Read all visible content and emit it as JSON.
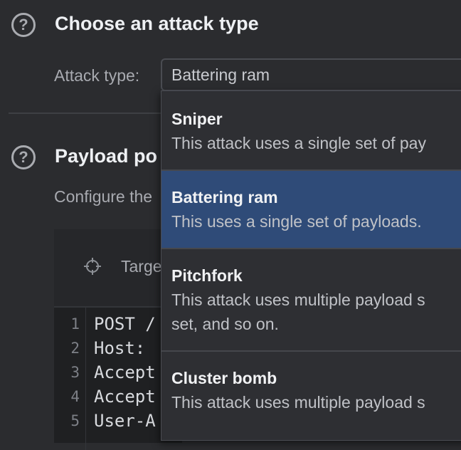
{
  "attack_section": {
    "help_glyph": "?",
    "title": "Choose an attack type",
    "attack_type_label": "Attack type:",
    "selected_value": "Battering ram"
  },
  "payload_section": {
    "help_glyph": "?",
    "title_partial": "Payload po",
    "description_partial": "Configure the"
  },
  "editor": {
    "target_label_partial": "Targe",
    "lines": [
      {
        "num": "1",
        "text": "POST /"
      },
      {
        "num": "2",
        "text": "Host:"
      },
      {
        "num": "3",
        "text": "Accept"
      },
      {
        "num": "4",
        "text": "Accept"
      },
      {
        "num": "5",
        "text": "User-A"
      }
    ]
  },
  "dropdown": {
    "options": [
      {
        "title": "Sniper",
        "desc_line1": "This attack uses a single set of pay",
        "desc_line2": "",
        "selected": false
      },
      {
        "title": "Battering ram",
        "desc_line1": "This uses a single set of payloads.",
        "desc_line2": "",
        "selected": true
      },
      {
        "title": "Pitchfork",
        "desc_line1": "This attack uses multiple payload s",
        "desc_line2": "set, and so on.",
        "selected": false
      },
      {
        "title": "Cluster bomb",
        "desc_line1": "This attack uses multiple payload s",
        "desc_line2": "",
        "selected": false
      }
    ]
  },
  "colors": {
    "background": "#2b2c2f",
    "selected_option": "#2f4b78",
    "dropdown_bg": "#2e2f33"
  },
  "icons": {
    "help": "question-circle-icon",
    "target": "crosshair-icon"
  }
}
